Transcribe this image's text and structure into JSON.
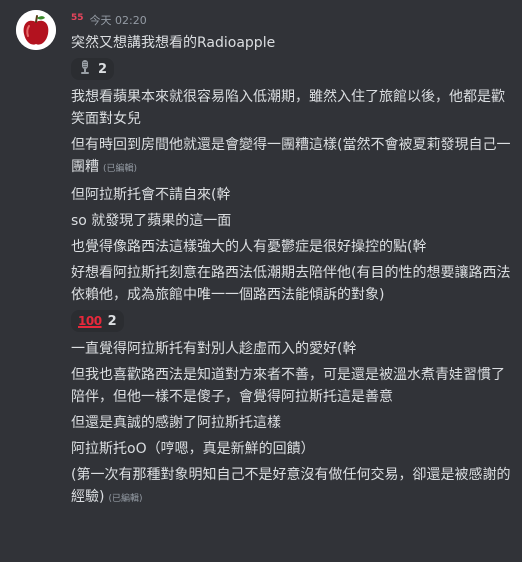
{
  "author": {
    "name": "55",
    "timestamp": "今天 02:20",
    "name_color": "#e6455c"
  },
  "messages": [
    {
      "text": "突然又想講我想看的Radioapple"
    },
    {
      "reaction": {
        "icon": "microphone-emoji",
        "count": "2"
      }
    },
    {
      "text": "我想看蘋果本來就很容易陷入低潮期，雖然入住了旅館以後，他都是歡笑面對女兒"
    },
    {
      "text": "但有時回到房間他就還是會變得一團糟這樣(當然不會被夏莉發現自己一團糟",
      "edited": "(已編輯)"
    },
    {
      "text": "但阿拉斯托會不請自來(幹"
    },
    {
      "text": "so 就發現了蘋果的這一面"
    },
    {
      "text": "也覺得像路西法這樣強大的人有憂鬱症是很好操控的點(幹"
    },
    {
      "text": "好想看阿拉斯托刻意在路西法低潮期去陪伴他(有目的性的想要讓路西法依賴他，成為旅館中唯一一個路西法能傾訴的對象)"
    },
    {
      "reaction": {
        "icon": "hundred-points-emoji",
        "emoji_text": "100",
        "count": "2"
      }
    },
    {
      "text": "一直覺得阿拉斯托有對別人趁虛而入的愛好(幹"
    },
    {
      "text": "但我也喜歡路西法是知道對方來者不善，可是還是被溫水煮青娃習慣了陪伴，但他一樣不是傻子，會覺得阿拉斯托這是善意"
    },
    {
      "text": "但還是真誠的感謝了阿拉斯托這樣"
    },
    {
      "text": "阿拉斯托oO（哼嗯，真是新鮮的回饋）"
    },
    {
      "text": "(第一次有那種對象明知自己不是好意沒有做任何交易，卻還是被感謝的經驗)",
      "edited": "(已編輯)"
    }
  ]
}
